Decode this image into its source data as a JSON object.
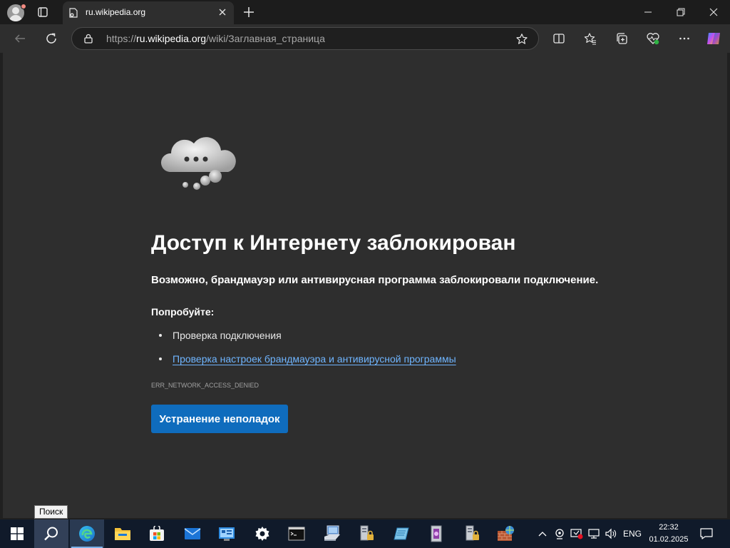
{
  "browser": {
    "tab_title": "ru.wikipedia.org",
    "url_prefix": "https://",
    "url_host": "ru.wikipedia.org",
    "url_path": "/wiki/Заглавная_страница",
    "icons": [
      "profile-icon",
      "tab-actions-icon",
      "wikipedia-favicon",
      "close-tab-icon",
      "new-tab-icon",
      "minimize-icon",
      "restore-icon",
      "close-window-icon",
      "back-icon",
      "refresh-icon",
      "lock-icon",
      "favorite-star-icon",
      "split-screen-icon",
      "favorites-icon",
      "collections-icon",
      "browser-essentials-icon",
      "more-icon",
      "copilot-icon"
    ]
  },
  "error": {
    "title": "Доступ к Интернету заблокирован",
    "subtitle": "Возможно, брандмауэр или антивирусная программа заблокировали подключение.",
    "try_label": "Попробуйте:",
    "suggestions": [
      "Проверка подключения",
      "Проверка настроек брандмауэра и антивирусной программы"
    ],
    "code": "ERR_NETWORK_ACCESS_DENIED",
    "button": "Устранение неполадок"
  },
  "tooltip": "Поиск",
  "taskbar": {
    "apps": [
      "start",
      "search",
      "edge",
      "file-explorer",
      "microsoft-store",
      "mail",
      "control-panel",
      "settings",
      "command-prompt",
      "network-computer",
      "server-lock",
      "notepad",
      "registry",
      "server-lock-2",
      "firewall"
    ],
    "language": "ENG",
    "time": "22:32",
    "date": "01.02.2025"
  },
  "colors": {
    "accent_blue": "#0f6cbd",
    "link_blue": "#6fb5ff",
    "page_bg": "#2e2e2e",
    "taskbar_bg": "#101a2a"
  }
}
